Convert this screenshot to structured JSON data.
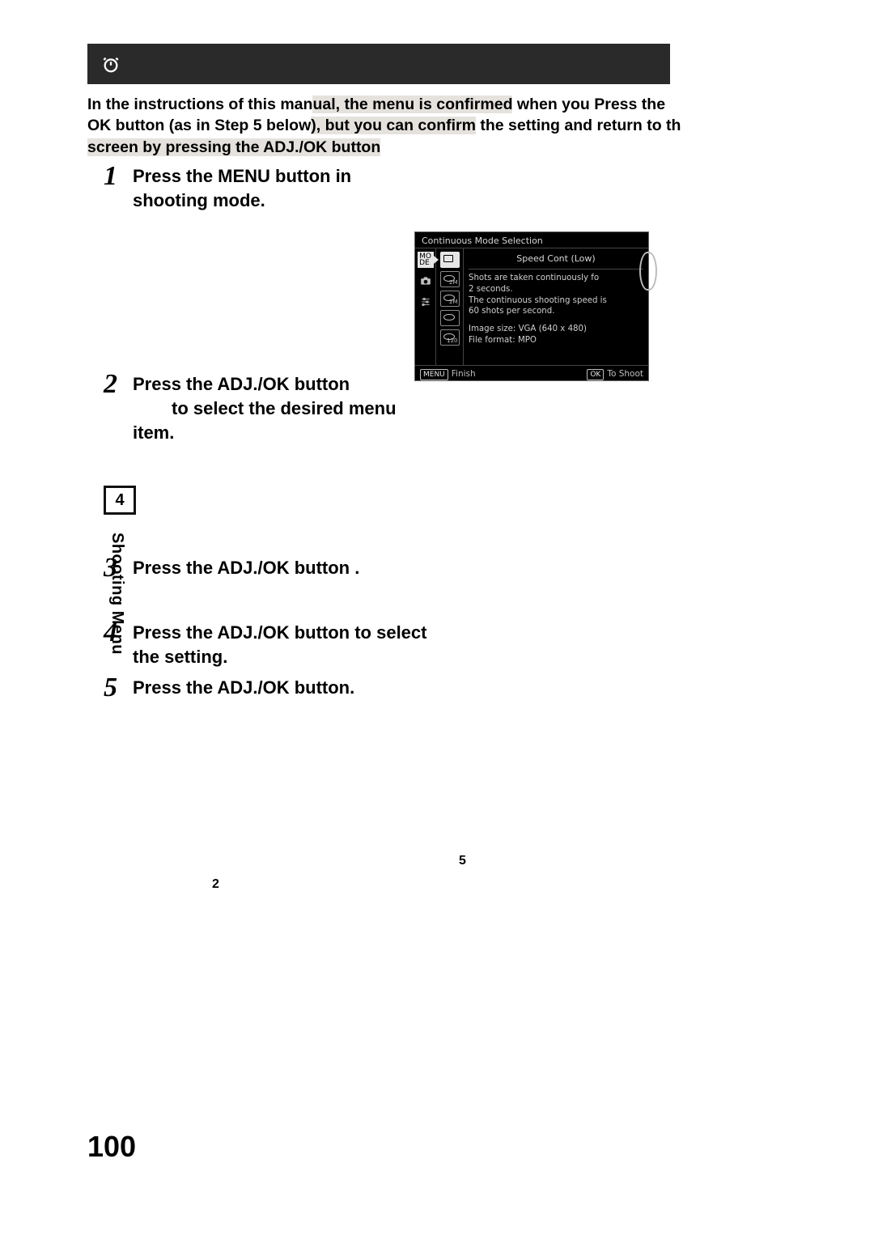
{
  "intro": {
    "line1a": "In the instructions of this man",
    "line1b_hl": "ual, the menu is confirmed",
    "line1c": " when you Press the",
    "line2a": "OK button (as in Step 5 below",
    "line2b_hl": "), but you can confirm",
    "line2c": " the setting and return to th",
    "line3_hl": "screen by pressing the ADJ./OK button"
  },
  "steps": {
    "s1": {
      "text": "Press the MENU button in shooting mode."
    },
    "s2": {
      "line1": "Press the ADJ./OK button",
      "line2": "to select the desired menu",
      "line3": "item."
    },
    "s3": {
      "text": "Press the ADJ./OK button    ."
    },
    "s4": {
      "text": "Press the ADJ./OK button to select the setting."
    },
    "s5": {
      "text": "Press the ADJ./OK button."
    }
  },
  "camera": {
    "title": "Continuous Mode Selection",
    "mode_tab": "MO\nDE",
    "mode_label": "Speed Cont (Low)",
    "desc_l1": "Shots are taken continuously fo",
    "desc_l2": "2 seconds.",
    "desc_l3": "The continuous shooting speed is",
    "desc_l4": "60 shots per second.",
    "meta_l1": "Image size: VGA (640 x 480)",
    "meta_l2": "File format: MPO",
    "foot_menu_key": "MENU",
    "foot_menu": "Finish",
    "foot_ok_key": "OK",
    "foot_ok": "To Shoot",
    "thumbs": [
      "",
      "2M",
      "2M",
      "",
      "120"
    ]
  },
  "side": {
    "tab": "4",
    "label": "Shooting Menu"
  },
  "mini": {
    "a": "5",
    "b": "2"
  },
  "page_number": "100"
}
